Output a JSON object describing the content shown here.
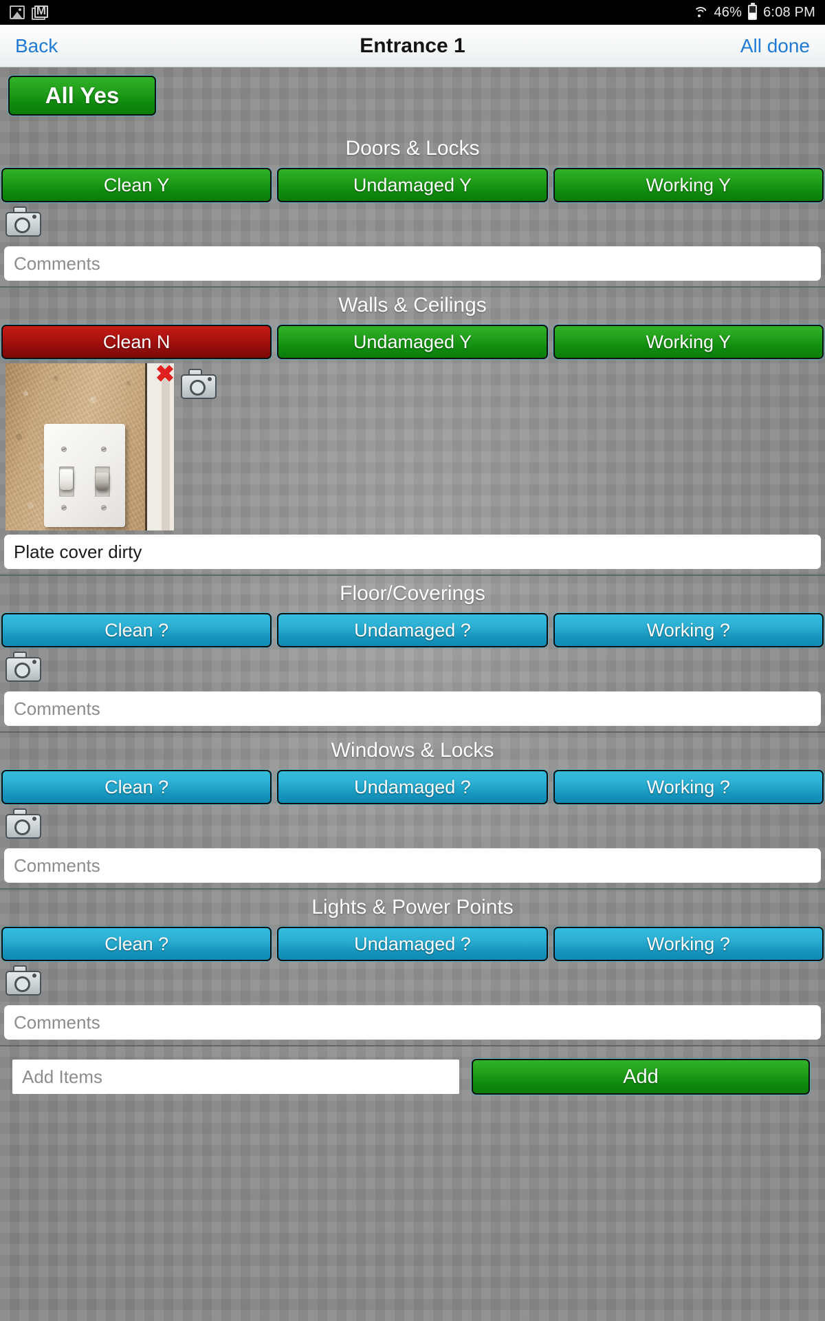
{
  "statusbar": {
    "left_icons": [
      "photo-icon",
      "gmail-icon"
    ],
    "wifi_icon": "wifi-icon",
    "battery_percent": "46%",
    "battery_icon": "battery-icon",
    "time": "6:08 PM"
  },
  "navbar": {
    "back_label": "Back",
    "title": "Entrance 1",
    "done_label": "All done"
  },
  "toolbar": {
    "all_yes_label": "All Yes"
  },
  "sections": [
    {
      "title": "Doors & Locks",
      "buttons": [
        {
          "label": "Clean Y",
          "state": "yes"
        },
        {
          "label": "Undamaged Y",
          "state": "yes"
        },
        {
          "label": "Working Y",
          "state": "yes"
        }
      ],
      "camera_icon": "camera-icon",
      "photo": null,
      "comment_value": "",
      "comment_placeholder": "Comments"
    },
    {
      "title": "Walls & Ceilings",
      "buttons": [
        {
          "label": "Clean N",
          "state": "no"
        },
        {
          "label": "Undamaged Y",
          "state": "yes"
        },
        {
          "label": "Working Y",
          "state": "yes"
        }
      ],
      "camera_icon": "camera-icon",
      "photo": {
        "description": "light switch plate on textured beige wall",
        "delete_label": "✖"
      },
      "comment_value": "Plate cover dirty",
      "comment_placeholder": "Comments"
    },
    {
      "title": "Floor/Coverings",
      "buttons": [
        {
          "label": "Clean ?",
          "state": "unknown"
        },
        {
          "label": "Undamaged ?",
          "state": "unknown"
        },
        {
          "label": "Working ?",
          "state": "unknown"
        }
      ],
      "camera_icon": "camera-icon",
      "photo": null,
      "comment_value": "",
      "comment_placeholder": "Comments"
    },
    {
      "title": "Windows & Locks",
      "buttons": [
        {
          "label": "Clean ?",
          "state": "unknown"
        },
        {
          "label": "Undamaged ?",
          "state": "unknown"
        },
        {
          "label": "Working ?",
          "state": "unknown"
        }
      ],
      "camera_icon": "camera-icon",
      "photo": null,
      "comment_value": "",
      "comment_placeholder": "Comments"
    },
    {
      "title": "Lights & Power Points",
      "buttons": [
        {
          "label": "Clean ?",
          "state": "unknown"
        },
        {
          "label": "Undamaged ?",
          "state": "unknown"
        },
        {
          "label": "Working ?",
          "state": "unknown"
        }
      ],
      "camera_icon": "camera-icon",
      "photo": null,
      "comment_value": "",
      "comment_placeholder": "Comments"
    }
  ],
  "add_row": {
    "input_placeholder": "Add Items",
    "input_value": "",
    "button_label": "Add"
  },
  "colors": {
    "yes_green": "#17980f",
    "no_red": "#a3120f",
    "unknown_teal": "#2cb0d4",
    "link_blue": "#1f7bd6",
    "page_bg": "#8f8f8f"
  }
}
